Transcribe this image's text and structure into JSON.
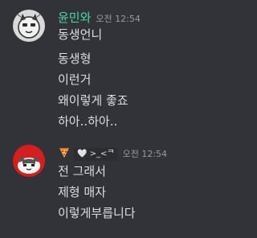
{
  "colors": {
    "background": "#313338",
    "username_1": "#4fd4a4",
    "username_2": "#dbdee1",
    "text": "#dbdee1",
    "muted": "#949ba4"
  },
  "messages": [
    {
      "username": "윤민와",
      "time": "오전 12:54",
      "avatar_icon": "gray-cat-avatar",
      "lines": [
        "동생언니",
        "동생형",
        "이런거",
        "왜이렇게 좋죠",
        "하아..하아.."
      ]
    },
    {
      "username": "",
      "badge_icon": "pizza-icon",
      "tag": "🤍 >_<ᄏ",
      "time": "오전 12:54",
      "avatar_icon": "red-cat-avatar",
      "lines": [
        "전 그래서",
        "제형 매자",
        "이렇게부릅니다"
      ]
    }
  ]
}
